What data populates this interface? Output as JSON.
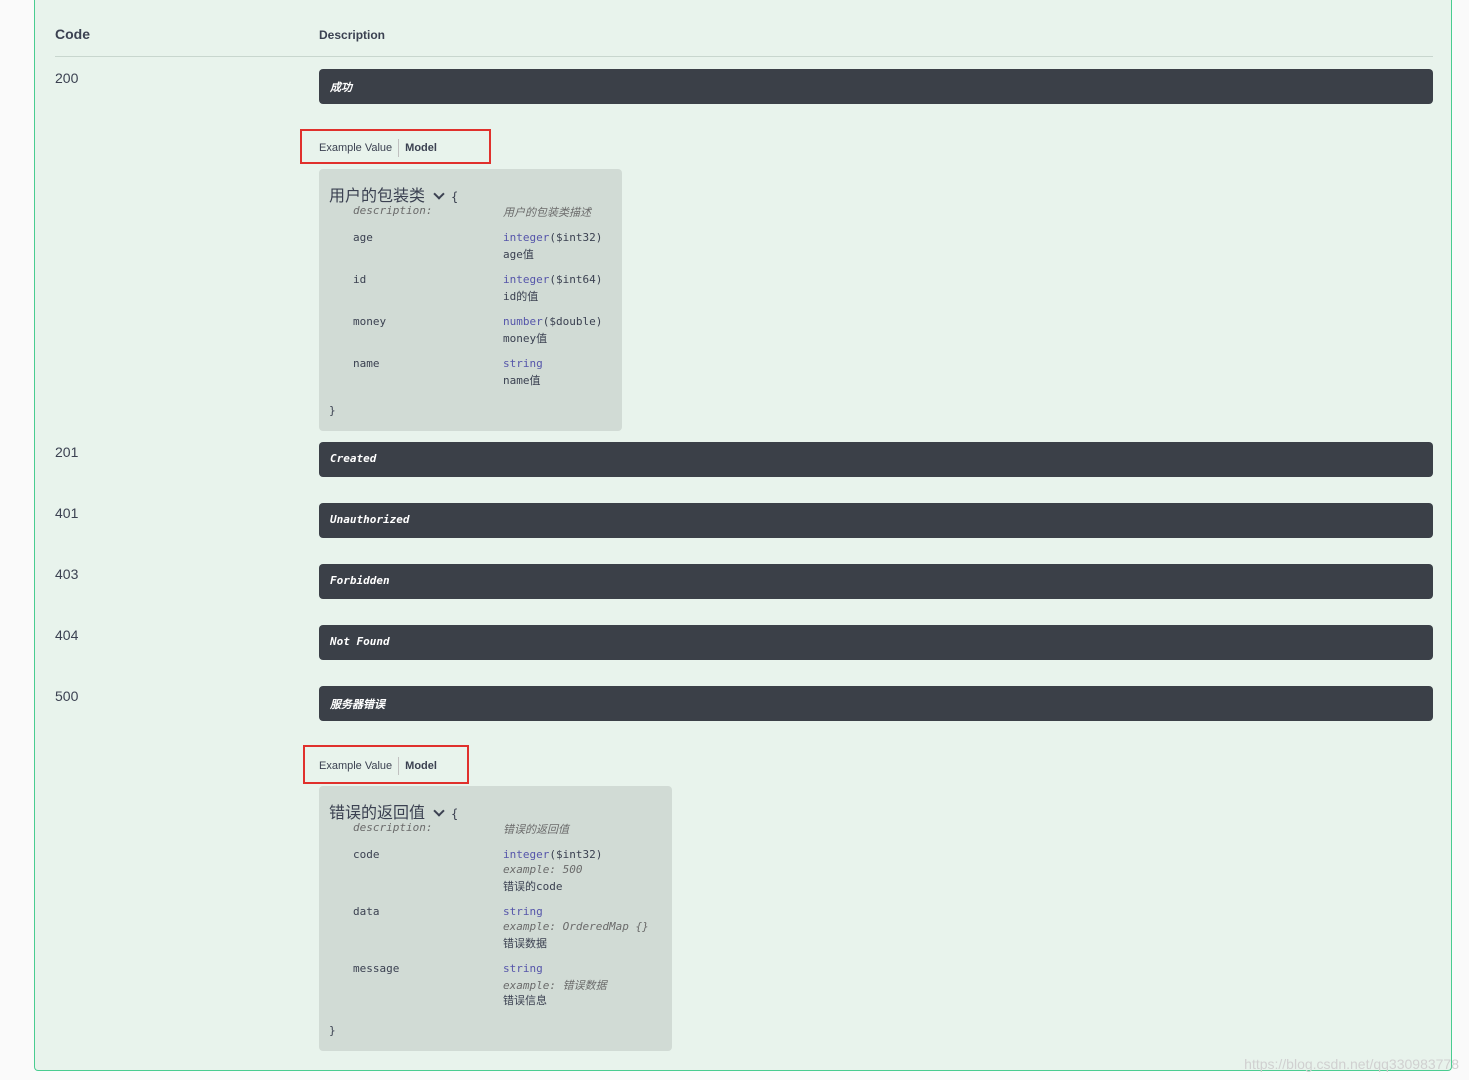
{
  "headers": {
    "code": "Code",
    "description": "Description"
  },
  "responses": [
    {
      "code": "200",
      "description": "成功"
    },
    {
      "code": "201",
      "description": "Created"
    },
    {
      "code": "401",
      "description": "Unauthorized"
    },
    {
      "code": "403",
      "description": "Forbidden"
    },
    {
      "code": "404",
      "description": "Not Found"
    },
    {
      "code": "500",
      "description": "服务器错误"
    }
  ],
  "tabs": {
    "example": "Example Value",
    "model": "Model"
  },
  "model_200": {
    "title": "用户的包装类",
    "open_brace": "{",
    "close_brace": "}",
    "description_label": "description:",
    "description_value": "用户的包装类描述",
    "props": [
      {
        "name": "age",
        "type": "integer",
        "format": "($int32)",
        "desc": "age值"
      },
      {
        "name": "id",
        "type": "integer",
        "format": "($int64)",
        "desc": "id的值"
      },
      {
        "name": "money",
        "type": "number",
        "format": "($double)",
        "desc": "money值"
      },
      {
        "name": "name",
        "type": "string",
        "format": "",
        "desc": "name值"
      }
    ]
  },
  "model_500": {
    "title": "错误的返回值",
    "open_brace": "{",
    "close_brace": "}",
    "description_label": "description:",
    "description_value": "错误的返回值",
    "props": [
      {
        "name": "code",
        "type": "integer",
        "format": "($int32)",
        "example_label": "example:",
        "example": "500",
        "desc": "错误的code"
      },
      {
        "name": "data",
        "type": "string",
        "format": "",
        "example_label": "example:",
        "example": "OrderedMap {}",
        "desc": "错误数据"
      },
      {
        "name": "message",
        "type": "string",
        "format": "",
        "example_label": "example:",
        "example": "错误数据",
        "desc": "错误信息"
      }
    ]
  },
  "watermark": "https://blog.csdn.net/qq330983778"
}
